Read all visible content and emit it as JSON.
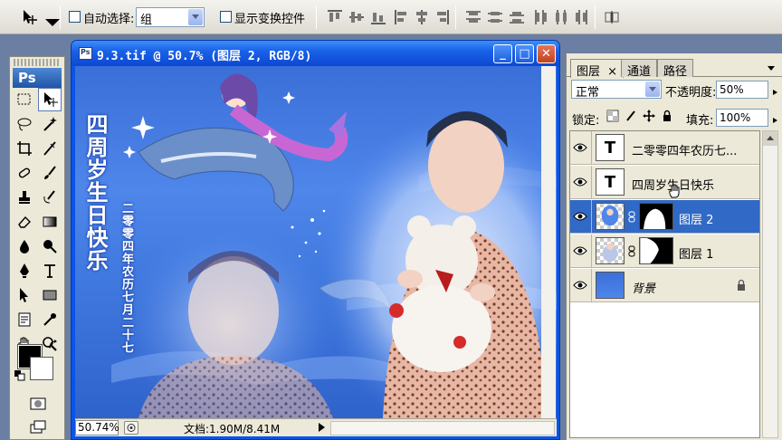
{
  "options_bar": {
    "auto_select_label": "自动选择:",
    "auto_select_value": "组",
    "show_transform_label": "显示变换控件"
  },
  "toolbox": {
    "logo": "Ps"
  },
  "document": {
    "title": "9.3.tif @ 50.7% (图层 2, RGB/8)",
    "zoom": "50.74%",
    "doc_size": "文档:1.90M/8.41M",
    "buttons": {
      "minimize": "_",
      "maximize": "□",
      "close": "✕"
    },
    "art": {
      "headline": "四周岁生日快乐",
      "date_line": "二零零四年农历七月二十七"
    }
  },
  "layers_panel": {
    "tabs": [
      {
        "label": "图层",
        "active": true
      },
      {
        "label": "通道",
        "active": false
      },
      {
        "label": "路径",
        "active": false
      }
    ],
    "tab_close": "×",
    "blend_mode": "正常",
    "opacity_label": "不透明度:",
    "opacity_value": "50%",
    "lock_label": "锁定:",
    "fill_label": "填充:",
    "fill_value": "100%",
    "layers": [
      {
        "name": "二零零四年农历七...",
        "type": "text",
        "thumb": "T",
        "selected": false
      },
      {
        "name": "四周岁生日快乐",
        "type": "text",
        "thumb": "T",
        "selected": false
      },
      {
        "name": "图层 2",
        "type": "image-mask",
        "selected": true
      },
      {
        "name": "图层 1",
        "type": "image-mask",
        "selected": false
      },
      {
        "name": "背景",
        "type": "background",
        "selected": false,
        "locked": true
      }
    ]
  },
  "colors": {
    "canvas_blue": "#3f78e0",
    "selection": "#3169c6",
    "title_bar": "#0c48d2",
    "close_button": "#c1421d"
  }
}
